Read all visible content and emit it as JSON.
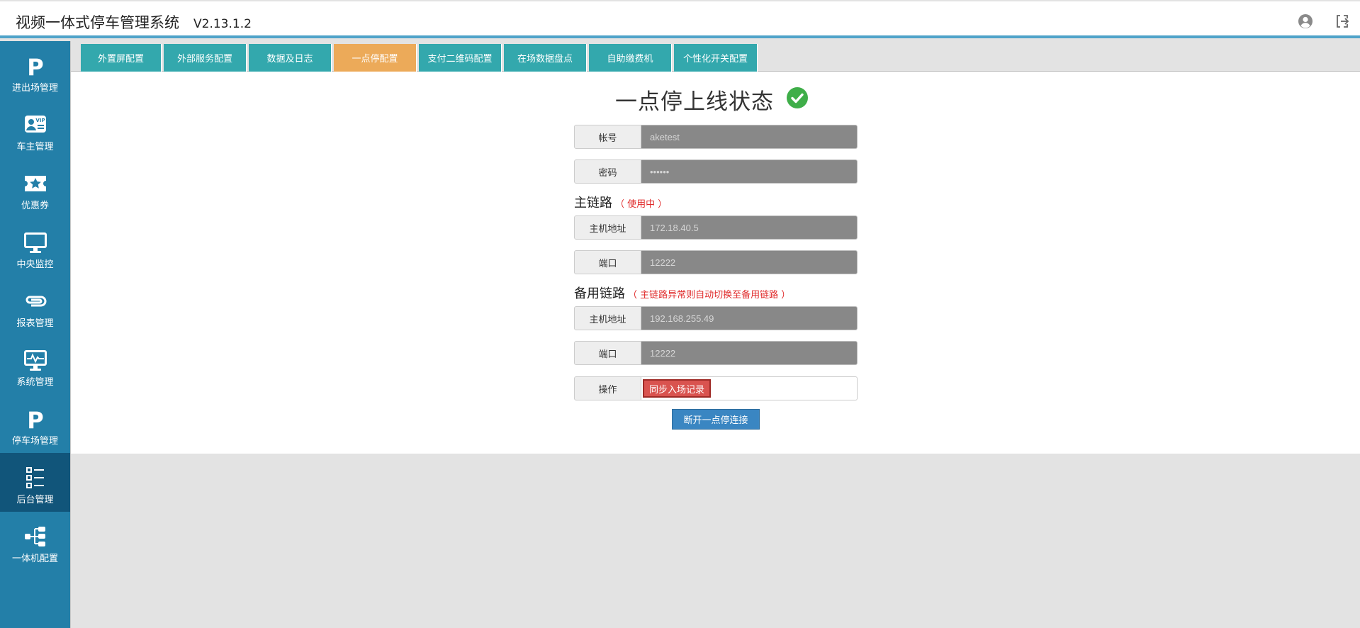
{
  "app": {
    "title": "视频一体式停车管理系统",
    "version": "V2.13.1.2"
  },
  "header": {
    "user_icon": "user-circle-icon",
    "logout_icon": "logout-icon"
  },
  "sidebar": {
    "items": [
      {
        "label": "进出场管理",
        "icon": "parking-p-icon",
        "active": false
      },
      {
        "label": "车主管理",
        "icon": "vip-card-icon",
        "active": false
      },
      {
        "label": "优惠券",
        "icon": "coupon-ticket-icon",
        "active": false
      },
      {
        "label": "中央监控",
        "icon": "monitor-icon",
        "active": false
      },
      {
        "label": "报表管理",
        "icon": "paperclip-icon",
        "active": false
      },
      {
        "label": "系统管理",
        "icon": "system-monitor-icon",
        "active": false
      },
      {
        "label": "停车场管理",
        "icon": "parking-p-icon",
        "active": false
      },
      {
        "label": "后台管理",
        "icon": "list-icon",
        "active": true
      },
      {
        "label": "一体机配置",
        "icon": "sitemap-icon",
        "active": false
      }
    ]
  },
  "tabs": [
    {
      "label": "外置屏配置",
      "active": false
    },
    {
      "label": "外部服务配置",
      "active": false
    },
    {
      "label": "数据及日志",
      "active": false
    },
    {
      "label": "一点停配置",
      "active": true
    },
    {
      "label": "支付二维码配置",
      "active": false
    },
    {
      "label": "在场数据盘点",
      "active": false
    },
    {
      "label": "自助缴费机",
      "active": false
    },
    {
      "label": "个性化开关配置",
      "active": false
    }
  ],
  "main": {
    "status_title": "一点停上线状态",
    "status_icon": "check-circle-icon",
    "account": {
      "label": "帐号",
      "value": "aketest"
    },
    "password": {
      "label": "密码",
      "value": "••••••"
    },
    "primary": {
      "title": "主链路",
      "note": "（ 使用中 ）",
      "host": {
        "label": "主机地址",
        "value": "172.18.40.5"
      },
      "port": {
        "label": "端口",
        "value": "12222"
      }
    },
    "backup": {
      "title": "备用链路",
      "note": "（ 主链路异常则自动切换至备用链路 ）",
      "host": {
        "label": "主机地址",
        "value": "192.168.255.49"
      },
      "port": {
        "label": "端口",
        "value": "12222"
      }
    },
    "operation": {
      "label": "操作",
      "sync_button": "同步入场记录"
    },
    "disconnect_button": "断开一点停连接"
  },
  "colors": {
    "sidebar": "#237fa8",
    "sidebar_active": "#11557a",
    "tab": "#33a8ad",
    "tab_active": "#ecaa59",
    "success": "#3fae49",
    "danger": "#d9534f",
    "primary_button": "#3a86c2",
    "note_red": "#e02a2a"
  }
}
